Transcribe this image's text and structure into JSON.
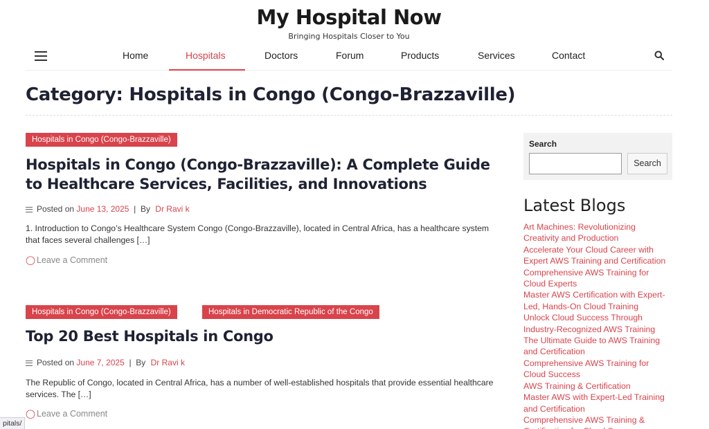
{
  "site": {
    "title": "My Hospital Now",
    "tagline": "Bringing Hospitals Closer to You"
  },
  "nav": {
    "items": [
      {
        "label": "Home"
      },
      {
        "label": "Hospitals",
        "active": true
      },
      {
        "label": "Doctors"
      },
      {
        "label": "Forum"
      },
      {
        "label": "Products"
      },
      {
        "label": "Services"
      },
      {
        "label": "Contact"
      }
    ]
  },
  "page": {
    "title": "Category: Hospitals in Congo (Congo-Brazzaville)"
  },
  "posts": [
    {
      "categories": [
        "Hospitals in Congo (Congo-Brazzaville)"
      ],
      "title": "Hospitals in Congo (Congo-Brazzaville): A Complete Guide to Healthcare Services, Facilities, and Innovations",
      "posted_on_label": "Posted on",
      "date": "June 13, 2025",
      "by_label": "By",
      "author": "Dr Ravi k",
      "excerpt": "1. Introduction to Congo’s Healthcare System Congo (Congo-Brazzaville), located in Central Africa, has a healthcare system that faces several challenges […]",
      "comment_label": "Leave a Comment"
    },
    {
      "categories": [
        "Hospitals in Congo (Congo-Brazzaville)",
        "Hospitals in Democratic Republic of the Congo"
      ],
      "title": "Top 20 Best Hospitals in Congo",
      "posted_on_label": "Posted on",
      "date": "June 7, 2025",
      "by_label": "By",
      "author": "Dr Ravi k",
      "excerpt": "The Republic of Congo, located in Central Africa, has a number of well-established hospitals that provide essential healthcare services. The […]",
      "comment_label": "Leave a Comment"
    }
  ],
  "sidebar": {
    "search": {
      "label": "Search",
      "button_label": "Search",
      "value": ""
    },
    "latest_heading": "Latest Blogs",
    "latest_blogs": [
      "Art Machines: Revolutionizing Creativity and Production",
      "Accelerate Your Cloud Career with Expert AWS Training and Certification",
      "Comprehensive AWS Training for Cloud Experts",
      "Master AWS Certification with Expert-Led, Hands-On Cloud Training",
      "Unlock Cloud Success Through Industry-Recognized AWS Training",
      "The Ultimate Guide to AWS Training and Certification",
      "Comprehensive AWS Training for Cloud Success",
      "AWS Training & Certification",
      "Master AWS with Expert-Led Training and Certification",
      "Comprehensive AWS Training & Certification for Cloud Success"
    ]
  },
  "status_bar": {
    "url_fragment": "pitals/"
  },
  "colors": {
    "accent": "#d9434b",
    "heading": "#1e2233",
    "widget_bg": "#f2f2f2"
  },
  "icons": {
    "menu": "hamburger-icon",
    "search": "search-icon",
    "meta": "lines-icon",
    "comment": "comment-icon"
  }
}
